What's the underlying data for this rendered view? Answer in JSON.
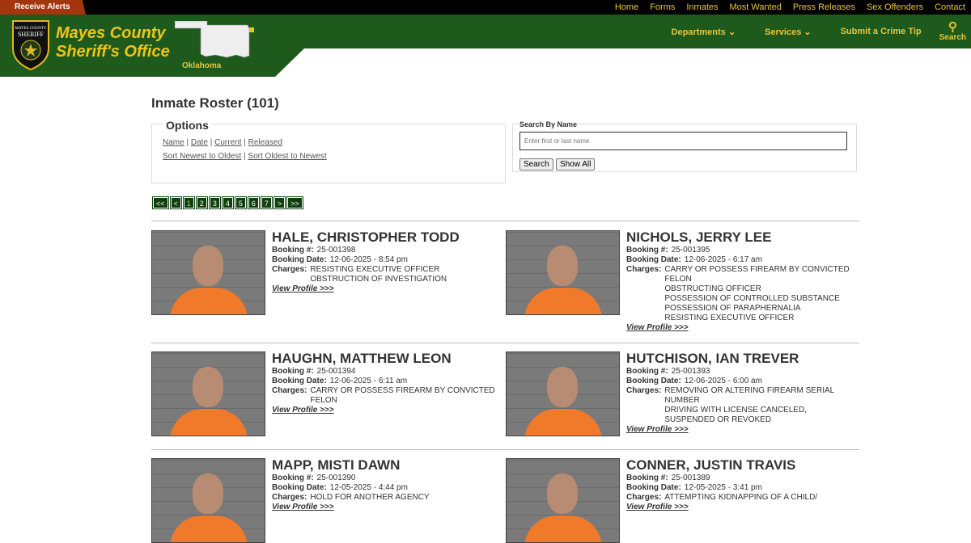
{
  "topbar": {
    "alerts": "Receive Alerts",
    "nav": [
      "Home",
      "Forms",
      "Inmates",
      "Most Wanted",
      "Press Releases",
      "Sex Offenders",
      "Contact"
    ]
  },
  "header": {
    "brand_line1": "Mayes County",
    "brand_line2": "Sheriff's Office",
    "state": "Oklahoma",
    "badge_text": "MAYES COUNTY SHERIFF",
    "nav": [
      "Departments",
      "Services",
      "Submit a Crime Tip"
    ],
    "search": "Search"
  },
  "page": {
    "title": "Inmate Roster (101)"
  },
  "options": {
    "legend": "Options",
    "filters": [
      "Name",
      "Date",
      "Current",
      "Released"
    ],
    "sorts": [
      "Sort Newest to Oldest",
      "Sort Oldest to Newest"
    ]
  },
  "search": {
    "label": "Search By Name",
    "placeholder": "Enter first or last name",
    "search_btn": "Search",
    "show_all_btn": "Show All"
  },
  "pager": [
    "<<",
    "<",
    "1",
    "2",
    "3",
    "4",
    "5",
    "6",
    "7",
    ">",
    ">>"
  ],
  "current_page": "1",
  "labels": {
    "booking_no": "Booking #:",
    "booking_date": "Booking Date:",
    "charges": "Charges:",
    "view": "View Profile >>>"
  },
  "inmates": [
    {
      "name": "HALE, CHRISTOPHER TODD",
      "booking": "25-001398",
      "date": "12-06-2025 - 8:54 pm",
      "charges": [
        "RESISTING EXECUTIVE OFFICER",
        "OBSTRUCTION OF INVESTIGATION"
      ]
    },
    {
      "name": "NICHOLS, JERRY LEE",
      "booking": "25-001395",
      "date": "12-06-2025 - 6:17 am",
      "charges": [
        "CARRY OR POSSESS FIREARM BY CONVICTED FELON",
        "OBSTRUCTING OFFICER",
        "POSSESSION OF CONTROLLED SUBSTANCE",
        "POSSESSION OF PARAPHERNALIA",
        "RESISTING EXECUTIVE OFFICER"
      ]
    },
    {
      "name": "HAUGHN, MATTHEW LEON",
      "booking": "25-001394",
      "date": "12-06-2025 - 6:11 am",
      "charges": [
        "CARRY OR POSSESS FIREARM BY CONVICTED FELON"
      ]
    },
    {
      "name": "HUTCHISON, IAN TREVER",
      "booking": "25-001393",
      "date": "12-06-2025 - 6:00 am",
      "charges": [
        "REMOVING OR ALTERING FIREARM SERIAL NUMBER",
        "DRIVING WITH LICENSE CANCELED, SUSPENDED OR REVOKED"
      ]
    },
    {
      "name": "MAPP, MISTI DAWN",
      "booking": "25-001390",
      "date": "12-05-2025 - 4:44 pm",
      "charges": [
        "HOLD FOR ANOTHER AGENCY"
      ]
    },
    {
      "name": "CONNER, JUSTIN TRAVIS",
      "booking": "25-001389",
      "date": "12-05-2025 - 3:41 pm",
      "charges": [
        "ATTEMPTING KIDNAPPING OF A CHILD/"
      ]
    }
  ],
  "colors": {
    "green": "#1f5a1d",
    "gold": "#f0c419",
    "alerts": "#a4360f",
    "pager": "#104010"
  }
}
